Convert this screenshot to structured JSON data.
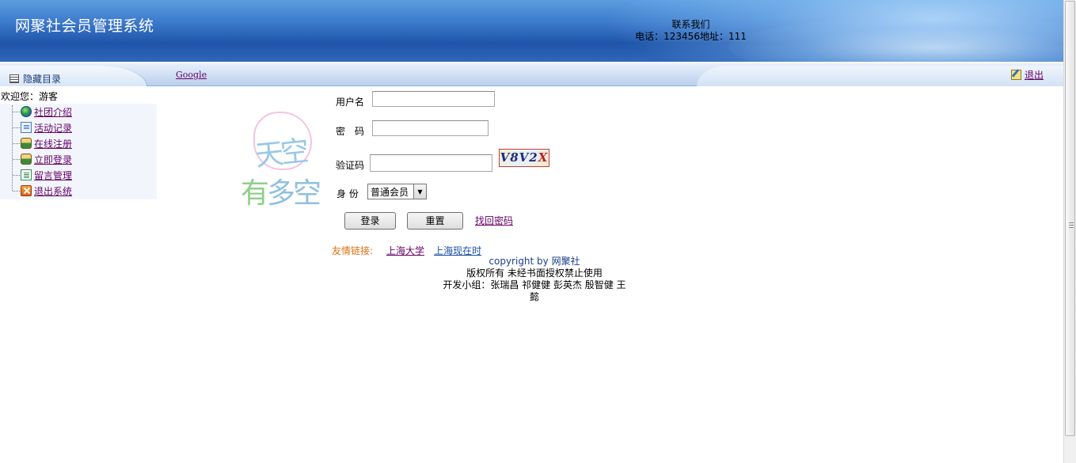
{
  "header": {
    "title": "网聚社会员管理系统",
    "contact_title": "联系我们",
    "contact_line": "电话：123456地址：111"
  },
  "navbar": {
    "toggle_label": "隐藏目录",
    "google_label": "Google",
    "logout_label": "退出"
  },
  "sidebar": {
    "welcome": "欢迎您：游客",
    "items": [
      {
        "label": "社团介绍",
        "icon": "globe-icon"
      },
      {
        "label": "活动记录",
        "icon": "doc-icon"
      },
      {
        "label": "在线注册",
        "icon": "user-icon"
      },
      {
        "label": "立即登录",
        "icon": "user-icon"
      },
      {
        "label": "留言管理",
        "icon": "note-icon"
      },
      {
        "label": "退出系统",
        "icon": "exit-icon"
      }
    ]
  },
  "art": {
    "line1": "天空",
    "line2a": "有",
    "line2b": "多空"
  },
  "login": {
    "username_label": "用户名",
    "username_value": "",
    "password_label": "密　码",
    "password_value": "",
    "captcha_label": "验证码",
    "captcha_value": "",
    "captcha_text_a": "V8V2",
    "captcha_text_b": "X",
    "role_label": "身 份",
    "role_selected": "普通会员",
    "login_button": "登录",
    "reset_button": "重置",
    "forgot_link": "找回密码"
  },
  "footer": {
    "links_label": "友情链接:",
    "links": [
      "上海大学",
      "上海现在时"
    ],
    "copyright": "copyright by 网聚社",
    "rights": "版权所有 未经书面授权禁止使用",
    "team": "开发小组：张瑞昌 祁健健 彭英杰 殷智健 王懿"
  },
  "colors": {
    "header_blue": "#2f66b8",
    "link_purple": "#660066",
    "link_label_orange": "#e07010"
  }
}
